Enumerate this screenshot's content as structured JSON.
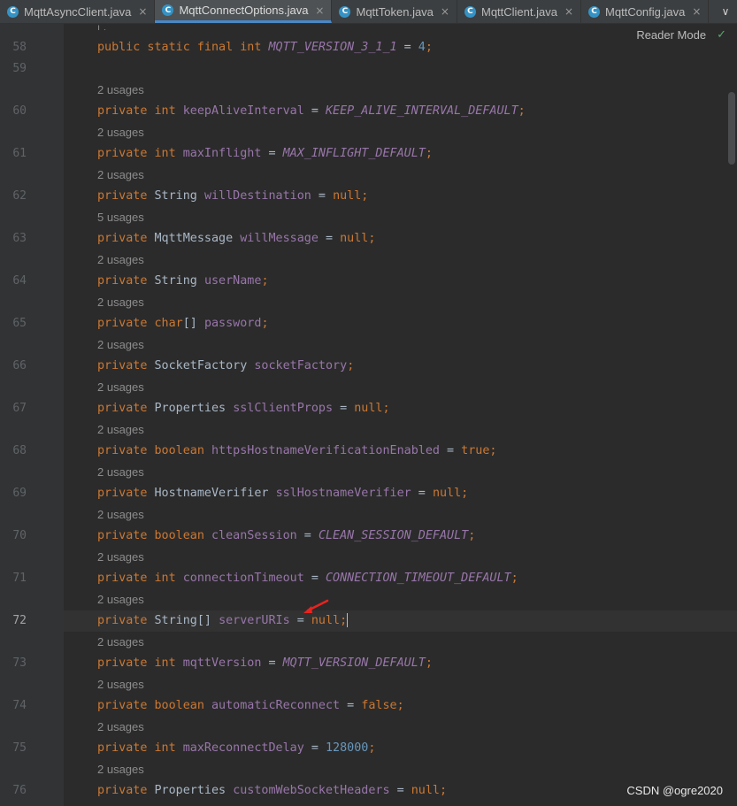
{
  "tabs": [
    {
      "label": "MqttAsyncClient.java",
      "active": false,
      "icon": "class-icon"
    },
    {
      "label": "MqttConnectOptions.java",
      "active": true,
      "icon": "class-icon"
    },
    {
      "label": "MqttToken.java",
      "active": false,
      "icon": "class-icon"
    },
    {
      "label": "MqttClient.java",
      "active": false,
      "icon": "class-icon"
    },
    {
      "label": "MqttConfig.java",
      "active": false,
      "icon": "class-icon"
    }
  ],
  "tab_icon_letter": "C",
  "close_glyph": "×",
  "more_glyph": "∨",
  "reader_mode_label": "Reader Mode",
  "check_glyph": "✓",
  "lines": [
    {
      "num": "58",
      "usage": "",
      "tokens": [
        [
          "kw",
          "public static final int "
        ],
        [
          "const",
          "MQTT_VERSION_3_1_1"
        ],
        [
          "plain",
          " = "
        ],
        [
          "num",
          "4"
        ],
        [
          "kw",
          ";"
        ]
      ]
    },
    {
      "num": "59",
      "usage": "",
      "tokens": []
    },
    {
      "num": "60",
      "usage": "2 usages",
      "tokens": [
        [
          "kw",
          "private int "
        ],
        [
          "fld",
          "keepAliveInterval"
        ],
        [
          "plain",
          " = "
        ],
        [
          "const",
          "KEEP_ALIVE_INTERVAL_DEFAULT"
        ],
        [
          "kw",
          ";"
        ]
      ]
    },
    {
      "num": "61",
      "usage": "2 usages",
      "tokens": [
        [
          "kw",
          "private int "
        ],
        [
          "fld",
          "maxInflight"
        ],
        [
          "plain",
          " = "
        ],
        [
          "const",
          "MAX_INFLIGHT_DEFAULT"
        ],
        [
          "kw",
          ";"
        ]
      ]
    },
    {
      "num": "62",
      "usage": "2 usages",
      "tokens": [
        [
          "kw",
          "private "
        ],
        [
          "plain",
          "String "
        ],
        [
          "fld",
          "willDestination"
        ],
        [
          "plain",
          " = "
        ],
        [
          "kw",
          "null;"
        ]
      ]
    },
    {
      "num": "63",
      "usage": "5 usages",
      "tokens": [
        [
          "kw",
          "private "
        ],
        [
          "plain",
          "MqttMessage "
        ],
        [
          "fld",
          "willMessage"
        ],
        [
          "plain",
          " = "
        ],
        [
          "kw",
          "null;"
        ]
      ]
    },
    {
      "num": "64",
      "usage": "2 usages",
      "tokens": [
        [
          "kw",
          "private "
        ],
        [
          "plain",
          "String "
        ],
        [
          "fld",
          "userName"
        ],
        [
          "kw",
          ";"
        ]
      ]
    },
    {
      "num": "65",
      "usage": "2 usages",
      "tokens": [
        [
          "kw",
          "private char"
        ],
        [
          "plain",
          "[] "
        ],
        [
          "fld",
          "password"
        ],
        [
          "kw",
          ";"
        ]
      ]
    },
    {
      "num": "66",
      "usage": "2 usages",
      "tokens": [
        [
          "kw",
          "private "
        ],
        [
          "plain",
          "SocketFactory "
        ],
        [
          "fld",
          "socketFactory"
        ],
        [
          "kw",
          ";"
        ]
      ]
    },
    {
      "num": "67",
      "usage": "2 usages",
      "tokens": [
        [
          "kw",
          "private "
        ],
        [
          "plain",
          "Properties "
        ],
        [
          "fld",
          "sslClientProps"
        ],
        [
          "plain",
          " = "
        ],
        [
          "kw",
          "null;"
        ]
      ]
    },
    {
      "num": "68",
      "usage": "2 usages",
      "tokens": [
        [
          "kw",
          "private boolean "
        ],
        [
          "fld",
          "httpsHostnameVerificationEnabled"
        ],
        [
          "plain",
          " = "
        ],
        [
          "kw",
          "true;"
        ]
      ]
    },
    {
      "num": "69",
      "usage": "2 usages",
      "tokens": [
        [
          "kw",
          "private "
        ],
        [
          "plain",
          "HostnameVerifier "
        ],
        [
          "fld",
          "sslHostnameVerifier"
        ],
        [
          "plain",
          " = "
        ],
        [
          "kw",
          "null;"
        ]
      ]
    },
    {
      "num": "70",
      "usage": "2 usages",
      "tokens": [
        [
          "kw",
          "private boolean "
        ],
        [
          "fld",
          "cleanSession"
        ],
        [
          "plain",
          " = "
        ],
        [
          "const",
          "CLEAN_SESSION_DEFAULT"
        ],
        [
          "kw",
          ";"
        ]
      ]
    },
    {
      "num": "71",
      "usage": "2 usages",
      "tokens": [
        [
          "kw",
          "private int "
        ],
        [
          "fld",
          "connectionTimeout"
        ],
        [
          "plain",
          " = "
        ],
        [
          "const",
          "CONNECTION_TIMEOUT_DEFAULT"
        ],
        [
          "kw",
          ";"
        ]
      ]
    },
    {
      "num": "72",
      "usage": "2 usages",
      "tokens": [
        [
          "kw",
          "private "
        ],
        [
          "plain",
          "String[] "
        ],
        [
          "fld",
          "serverURIs"
        ],
        [
          "plain",
          " = "
        ],
        [
          "kw",
          "null;"
        ]
      ]
    },
    {
      "num": "73",
      "usage": "2 usages",
      "tokens": [
        [
          "kw",
          "private int "
        ],
        [
          "fld",
          "mqttVersion"
        ],
        [
          "plain",
          " = "
        ],
        [
          "const",
          "MQTT_VERSION_DEFAULT"
        ],
        [
          "kw",
          ";"
        ]
      ]
    },
    {
      "num": "74",
      "usage": "2 usages",
      "tokens": [
        [
          "kw",
          "private boolean "
        ],
        [
          "fld",
          "automaticReconnect"
        ],
        [
          "plain",
          " = "
        ],
        [
          "kw",
          "false;"
        ]
      ]
    },
    {
      "num": "75",
      "usage": "2 usages",
      "tokens": [
        [
          "kw",
          "private int "
        ],
        [
          "fld",
          "maxReconnectDelay"
        ],
        [
          "plain",
          " = "
        ],
        [
          "num",
          "128000"
        ],
        [
          "kw",
          ";"
        ]
      ]
    },
    {
      "num": "76",
      "usage": "2 usages",
      "tokens": [
        [
          "kw",
          "private "
        ],
        [
          "plain",
          "Properties "
        ],
        [
          "fld",
          "customWebSocketHeaders"
        ],
        [
          "plain",
          " = "
        ],
        [
          "kw",
          "null;"
        ]
      ]
    }
  ],
  "current_line": "72",
  "annotation": {
    "icon": "red-arrow-icon",
    "color": "#e8231f"
  },
  "watermark": "CSDN @ogre2020",
  "colors": {
    "keyword": "#cc7832",
    "field": "#9876aa",
    "number": "#6897bb",
    "text": "#a9b7c6",
    "usage": "#8c8c8c",
    "tab_active_underline": "#4a88c7"
  }
}
